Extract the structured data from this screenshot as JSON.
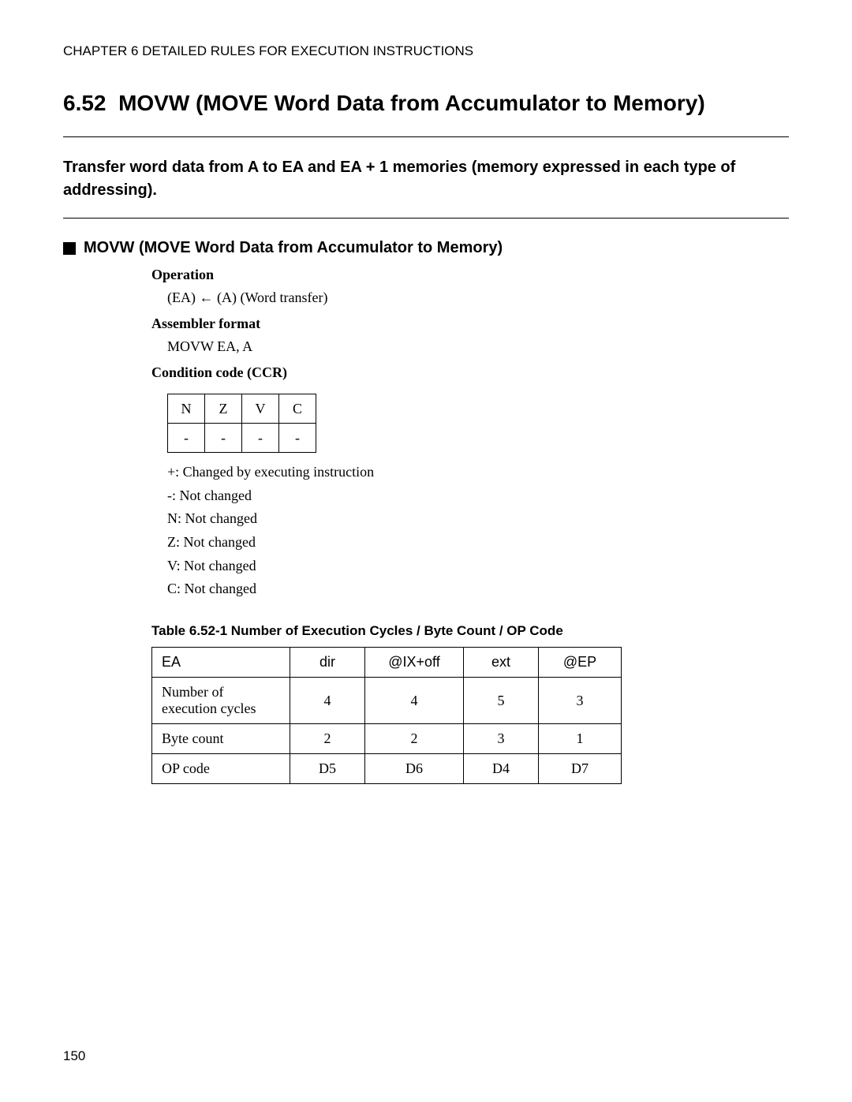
{
  "header": "CHAPTER 6  DETAILED RULES FOR EXECUTION INSTRUCTIONS",
  "section_number": "6.52",
  "section_title": "MOVW (MOVE Word Data from Accumulator to Memory)",
  "summary": "Transfer word data from A to EA and EA + 1 memories (memory expressed in each type of addressing).",
  "subhead": "MOVW (MOVE Word Data from Accumulator to Memory)",
  "labels": {
    "operation": "Operation",
    "assembler_format": "Assembler format",
    "condition_code": "Condition code (CCR)"
  },
  "operation_text": "(EA) ← (A) (Word transfer)",
  "assembler_text": "MOVW EA, A",
  "ccr_table": {
    "headers": [
      "N",
      "Z",
      "V",
      "C"
    ],
    "values": [
      "-",
      "-",
      "-",
      "-"
    ]
  },
  "legend": [
    "+: Changed by executing instruction",
    "-: Not changed",
    "N: Not changed",
    "Z: Not changed",
    "V: Not changed",
    "C: Not changed"
  ],
  "table_caption": "Table 6.52-1  Number of Execution Cycles / Byte Count / OP Code",
  "exec_table": {
    "columns": [
      "EA",
      "dir",
      "@IX+off",
      "ext",
      "@EP"
    ],
    "rows": [
      {
        "label": "Number of execution cycles",
        "values": [
          "4",
          "4",
          "5",
          "3"
        ]
      },
      {
        "label": "Byte count",
        "values": [
          "2",
          "2",
          "3",
          "1"
        ]
      },
      {
        "label": "OP code",
        "values": [
          "D5",
          "D6",
          "D4",
          "D7"
        ]
      }
    ]
  },
  "page_number": "150",
  "chart_data": {
    "type": "table",
    "title": "Number of Execution Cycles / Byte Count / OP Code",
    "columns": [
      "EA",
      "dir",
      "@IX+off",
      "ext",
      "@EP"
    ],
    "rows": [
      [
        "Number of execution cycles",
        4,
        4,
        5,
        3
      ],
      [
        "Byte count",
        2,
        2,
        3,
        1
      ],
      [
        "OP code",
        "D5",
        "D6",
        "D4",
        "D7"
      ]
    ]
  }
}
